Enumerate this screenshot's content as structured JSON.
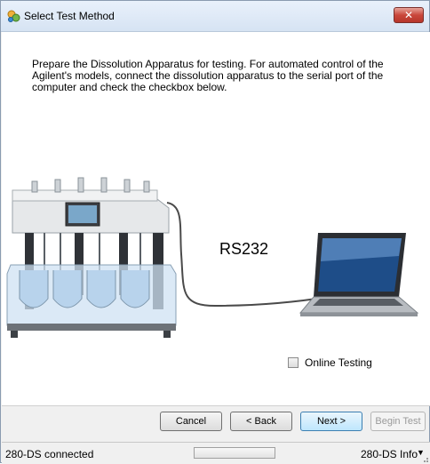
{
  "window": {
    "title": "Select Test Method",
    "close_label": "✕",
    "icon": "app-icon"
  },
  "main": {
    "instructions": "Prepare the Dissolution Apparatus for testing. For automated control of the Agilent's models, connect the dissolution apparatus to the serial port of the computer and check the checkbox below.",
    "illustration": {
      "connection_label": "RS232"
    },
    "online_testing": {
      "label": "Online Testing",
      "checked": false
    }
  },
  "buttons": {
    "cancel": "Cancel",
    "back": "< Back",
    "next": "Next >",
    "begin": "Begin Test"
  },
  "statusbar": {
    "status": "280-DS connected",
    "progress": 0,
    "info": "280-DS Info",
    "info_arrow": "▼"
  },
  "colors": {
    "close_button": "#c9473b",
    "primary_button": "#bee6fd",
    "title_bar": "#d6e3f3"
  }
}
